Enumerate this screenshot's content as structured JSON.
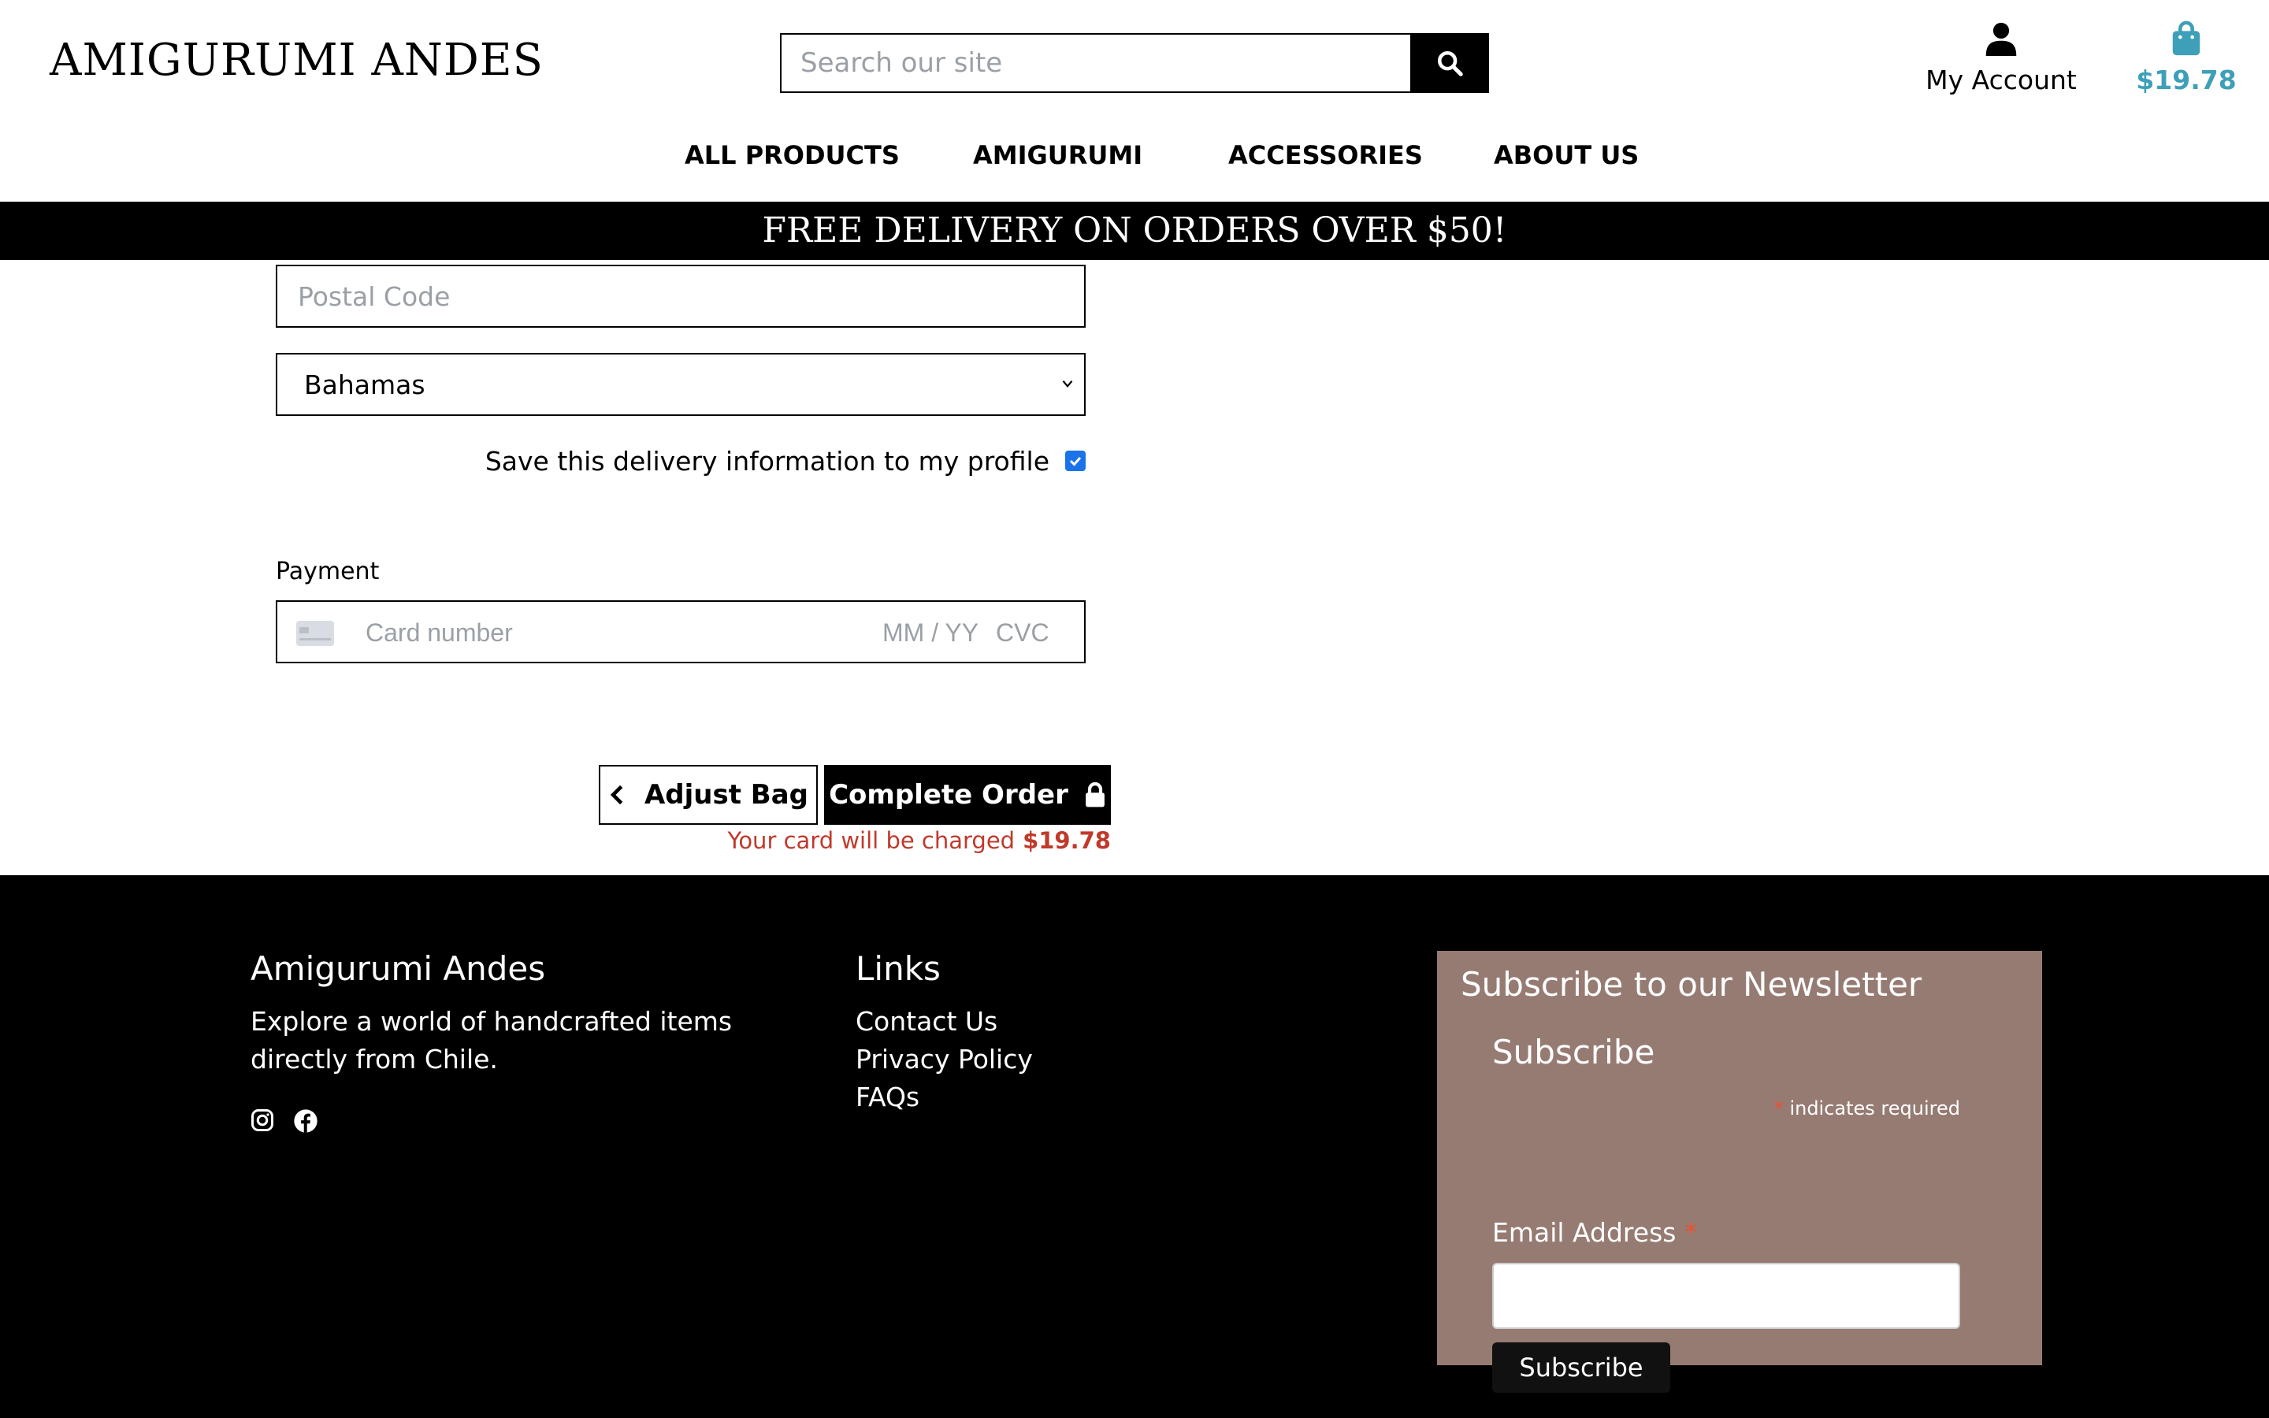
{
  "header": {
    "logo": "AMIGURUMI ANDES",
    "search_placeholder": "Search our site",
    "account_label": "My Account",
    "bag_total": "$19.78"
  },
  "nav": {
    "items": [
      "ALL PRODUCTS",
      "AMIGURUMI",
      "ACCESSORIES",
      "ABOUT US"
    ]
  },
  "banner": "FREE DELIVERY ON ORDERS OVER $50!",
  "form": {
    "postal_placeholder": "Postal Code",
    "country_value": "Bahamas",
    "save_label": "Save this delivery information to my profile",
    "save_checked": true,
    "payment_label": "Payment",
    "card_placeholder": "Card number",
    "expiry_placeholder": "MM / YY",
    "cvc_placeholder": "CVC"
  },
  "actions": {
    "adjust_label": "Adjust Bag",
    "complete_label": "Complete Order",
    "charge_text": "Your card will be charged",
    "charge_amount": "$19.78"
  },
  "footer": {
    "brand_title": "Amigurumi Andes",
    "brand_text": "Explore a world of handcrafted items directly from Chile.",
    "links_title": "Links",
    "links": [
      "Contact Us",
      "Privacy Policy",
      "FAQs"
    ],
    "social_icons": [
      "instagram-icon",
      "facebook-icon"
    ],
    "newsletter": {
      "title": "Subscribe to our Newsletter",
      "subtitle": "Subscribe",
      "required_note": "indicates required",
      "required_marker": "*",
      "email_label": "Email Address",
      "button_label": "Subscribe"
    }
  },
  "colors": {
    "accent": "#3e9fb9",
    "error": "#c0392b",
    "newsletter_bg": "#967b73",
    "checkbox": "#1a73e8"
  }
}
